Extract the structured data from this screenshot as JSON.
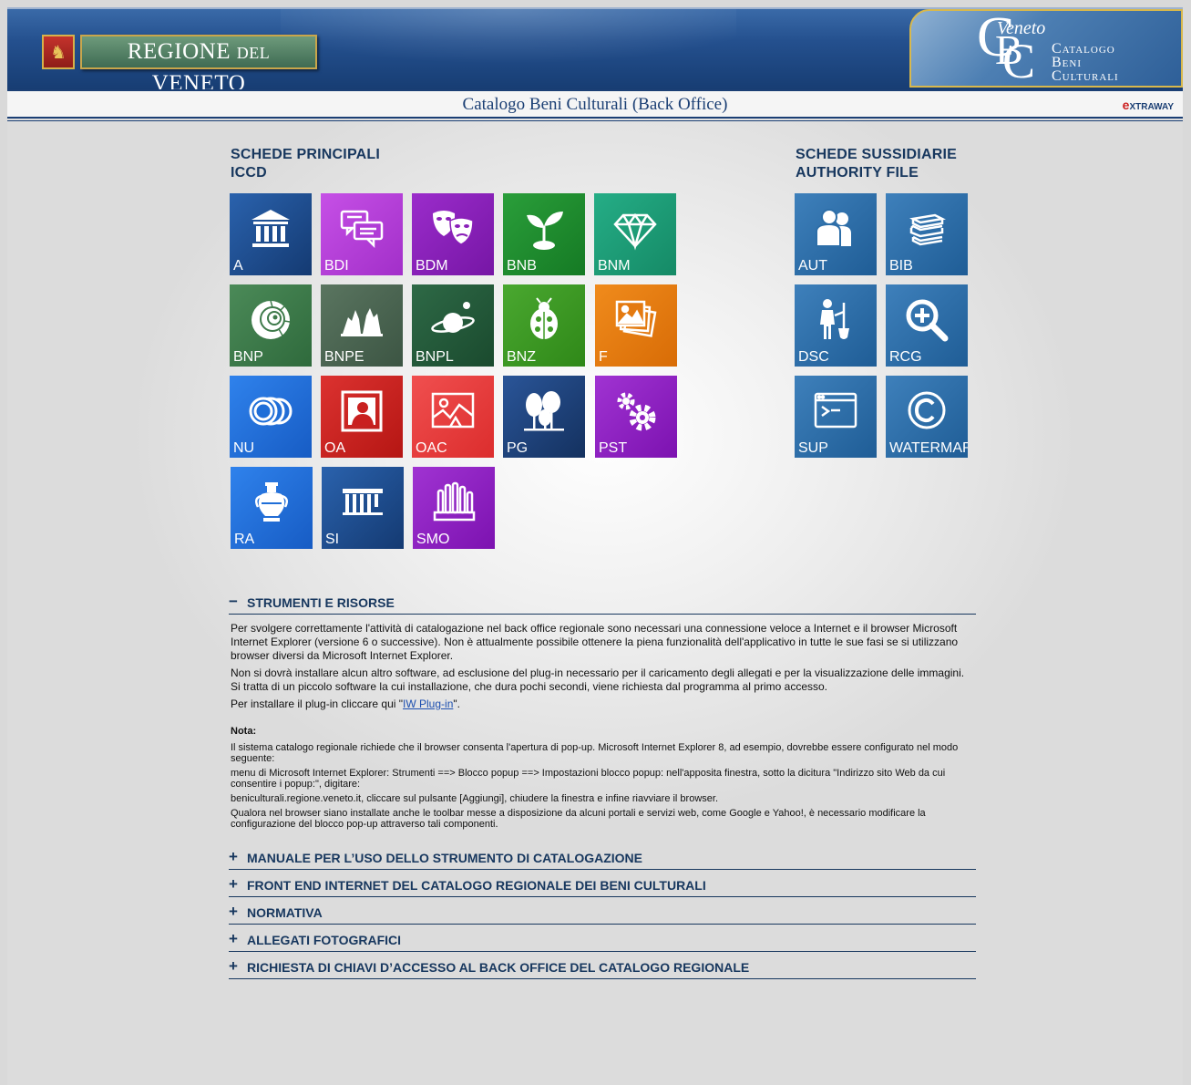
{
  "header": {
    "regione_main": "REGIONE",
    "regione_del": "DEL",
    "regione_veneto": "VENETO",
    "cbc_veneto": "Veneto",
    "cbc_line1": "Catalogo",
    "cbc_line2": "Beni",
    "cbc_line3": "Culturali",
    "page_title": "Catalogo Beni Culturali (Back Office)",
    "extraway": "XTRAWAY",
    "extraway_e": "e"
  },
  "principali": {
    "title_line1": "SCHEDE PRINCIPALI",
    "title_line2": "ICCD",
    "tiles": [
      {
        "label": "A",
        "icon": "building-icon",
        "color": "#1a4a8c"
      },
      {
        "label": "BDI",
        "icon": "speech-bubbles-icon",
        "color": "#b03cd6"
      },
      {
        "label": "BDM",
        "icon": "theater-masks-icon",
        "color": "#8a20b8"
      },
      {
        "label": "BNB",
        "icon": "sprout-icon",
        "color": "#1f8a2e"
      },
      {
        "label": "BNM",
        "icon": "diamond-icon",
        "color": "#1e9a76"
      },
      {
        "label": "BNP",
        "icon": "ammonite-icon",
        "color": "#3e7a4a"
      },
      {
        "label": "BNPE",
        "icon": "rock-formation-icon",
        "color": "#4a6350"
      },
      {
        "label": "BNPL",
        "icon": "planet-icon",
        "color": "#23553a"
      },
      {
        "label": "BNZ",
        "icon": "ladybug-icon",
        "color": "#3f9a26"
      },
      {
        "label": "F",
        "icon": "photos-icon",
        "color": "#e47a10"
      },
      {
        "label": "NU",
        "icon": "coins-icon",
        "color": "#1f6ed8"
      },
      {
        "label": "OA",
        "icon": "framed-portrait-icon",
        "color": "#c9201f"
      },
      {
        "label": "OAC",
        "icon": "contemporary-art-icon",
        "color": "#e73c3c"
      },
      {
        "label": "PG",
        "icon": "trees-icon",
        "color": "#1d3f78"
      },
      {
        "label": "PST",
        "icon": "gears-icon",
        "color": "#8f22c2"
      },
      {
        "label": "RA",
        "icon": "amphora-icon",
        "color": "#1f6ed8"
      },
      {
        "label": "SI",
        "icon": "ruins-icon",
        "color": "#1a4a8c"
      },
      {
        "label": "SMO",
        "icon": "organ-icon",
        "color": "#8f22c2"
      }
    ]
  },
  "sussidiarie": {
    "title_line1": "SCHEDE SUSSIDIARIE",
    "title_line2": "AUTHORITY FILE",
    "tiles": [
      {
        "label": "AUT",
        "icon": "people-icon",
        "color": "#2d6ea8"
      },
      {
        "label": "BIB",
        "icon": "books-icon",
        "color": "#2d6ea8"
      },
      {
        "label": "DSC",
        "icon": "digger-icon",
        "color": "#2d6ea8"
      },
      {
        "label": "RCG",
        "icon": "magnifier-plus-icon",
        "color": "#2d6ea8"
      },
      {
        "label": "SUP",
        "icon": "terminal-icon",
        "color": "#2d6ea8"
      },
      {
        "label": "WATERMARK",
        "icon": "copyright-icon",
        "color": "#2d6ea8"
      }
    ]
  },
  "strumenti": {
    "sign": "−",
    "title": "STRUMENTI E RISORSE",
    "p1": "Per svolgere correttamente l'attività di catalogazione nel back office regionale sono necessari una connessione veloce a Internet e il browser Microsoft Internet Explorer (versione 6 o successive). Non è attualmente possibile ottenere la piena funzionalità dell'applicativo in tutte le sue fasi se si utilizzano browser diversi da Microsoft Internet Explorer.",
    "p2": "Non si dovrà installare alcun altro software, ad esclusione del plug-in necessario per il caricamento degli allegati e per la visualizzazione delle immagini. Si tratta di un piccolo software la cui installazione, che dura pochi secondi, viene richiesta dal programma al primo accesso.",
    "p3_before": "Per installare il plug-in cliccare qui \"",
    "p3_link": "IW Plug-in",
    "p3_after": "\".",
    "note_title": "Nota:",
    "n1": "Il sistema catalogo regionale richiede che il browser consenta l'apertura di pop-up. Microsoft Internet Explorer 8, ad esempio, dovrebbe essere configurato nel modo seguente:",
    "n2": "menu di Microsoft Internet Explorer: Strumenti ==> Blocco popup ==> Impostazioni blocco popup:  nell'apposita finestra, sotto la dicitura \"Indirizzo sito Web da cui consentire i popup:\", digitare:",
    "n3": "beniculturali.regione.veneto.it, cliccare sul pulsante [Aggiungi], chiudere la finestra e infine riavviare il browser.",
    "n4": "Qualora nel browser siano installate anche le toolbar messe a disposizione da alcuni portali e servizi web, come Google e Yahoo!, è necessario modificare la configurazione del blocco pop-up attraverso tali componenti."
  },
  "accordion": [
    {
      "sign": "+",
      "title": "MANUALE PER L’USO DELLO STRUMENTO DI CATALOGAZIONE"
    },
    {
      "sign": "+",
      "title": "FRONT END INTERNET DEL CATALOGO REGIONALE DEI BENI CULTURALI"
    },
    {
      "sign": "+",
      "title": "NORMATIVA"
    },
    {
      "sign": "+",
      "title": "ALLEGATI FOTOGRAFICI"
    },
    {
      "sign": "+",
      "title": "RICHIESTA DI CHIAVI D’ACCESSO AL BACK OFFICE DEL CATALOGO REGIONALE"
    }
  ]
}
